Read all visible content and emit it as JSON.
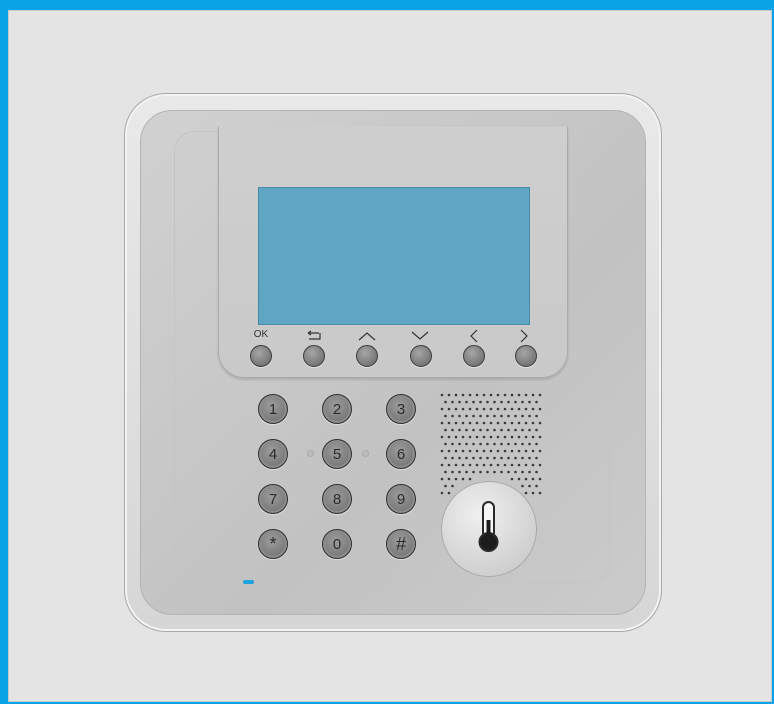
{
  "device": {
    "nav_buttons": [
      {
        "label": "OK",
        "icon": "ok-label"
      },
      {
        "label": "",
        "icon": "back-arrow-icon"
      },
      {
        "label": "",
        "icon": "up-arrow-icon"
      },
      {
        "label": "",
        "icon": "down-arrow-icon"
      },
      {
        "label": "",
        "icon": "left-arrow-icon"
      },
      {
        "label": "",
        "icon": "right-arrow-icon"
      }
    ],
    "keypad": [
      "1",
      "2",
      "3",
      "4",
      "5",
      "6",
      "7",
      "8",
      "9",
      "*",
      "0",
      "#"
    ],
    "screen_color": "#5ea6c4",
    "accent_color": "#0aa3e6",
    "sensor_icon": "thermometer-icon"
  }
}
